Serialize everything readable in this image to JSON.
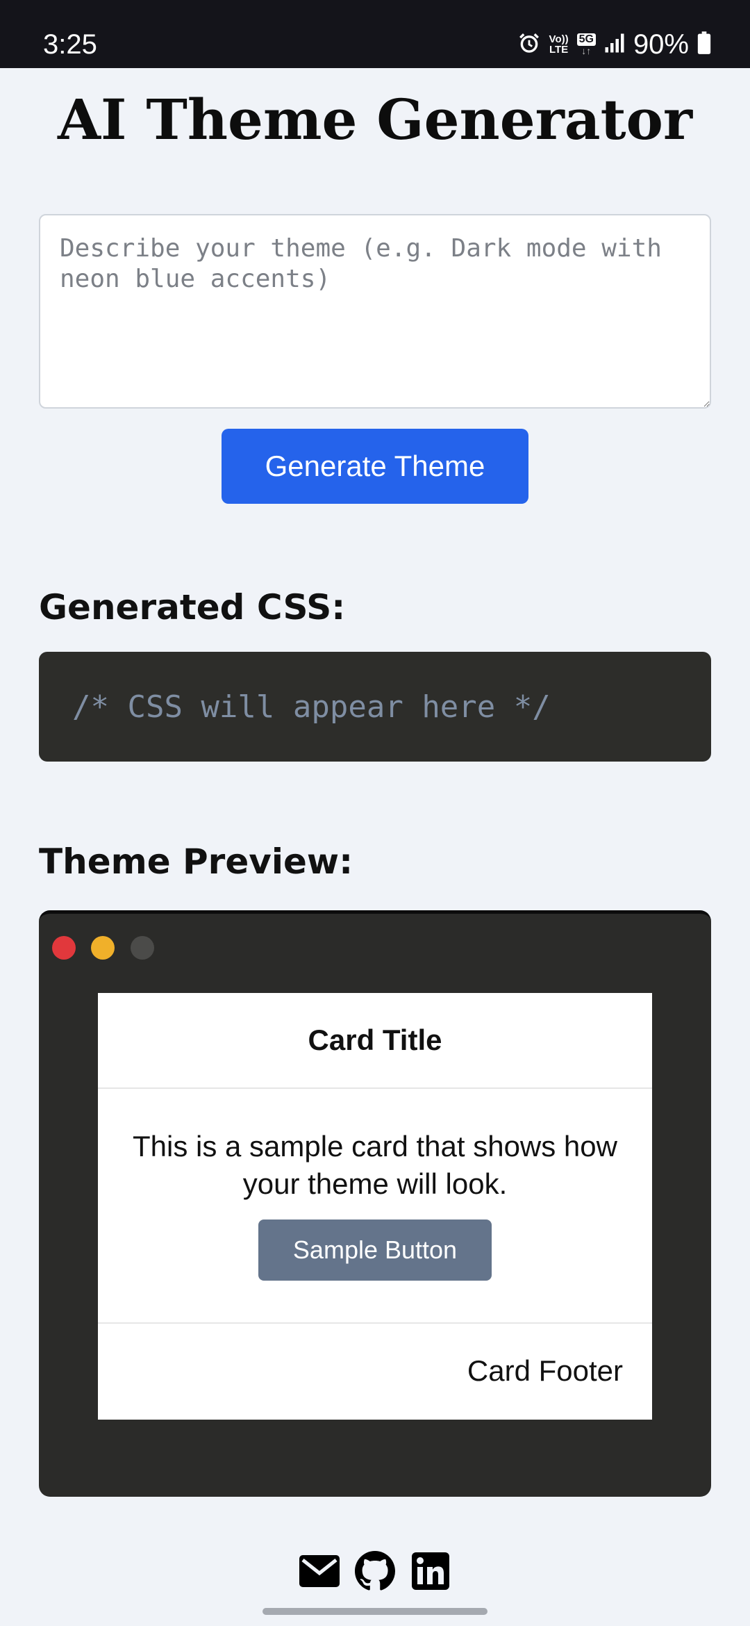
{
  "status_bar": {
    "time": "3:25",
    "volte_label_top": "Vo))",
    "volte_label_bottom": "LTE",
    "network": "5G",
    "battery": "90%",
    "icons": [
      "alarm-icon",
      "volte-icon",
      "network-5g-icon",
      "signal-icon",
      "battery-icon"
    ]
  },
  "page": {
    "title": "AI Theme Generator"
  },
  "prompt": {
    "placeholder": "Describe your theme (e.g. Dark mode with neon blue accents)",
    "value": ""
  },
  "generate_button": {
    "label": "Generate Theme"
  },
  "css_section": {
    "heading": "Generated CSS:",
    "output": "/* CSS will appear here */"
  },
  "preview_section": {
    "heading": "Theme Preview:",
    "card": {
      "title": "Card Title",
      "body": "This is a sample card that shows how your theme will look.",
      "button_label": "Sample Button",
      "footer": "Card Footer"
    }
  },
  "footer": {
    "links": [
      "email-icon",
      "github-icon",
      "linkedin-icon"
    ]
  },
  "colors": {
    "accent": "#2563eb",
    "sample_button": "#64748b",
    "code_background": "#2d2d2a",
    "window_close": "#e1383c",
    "window_minimize": "#f0b02a",
    "window_maximize": "#4b4b49"
  }
}
